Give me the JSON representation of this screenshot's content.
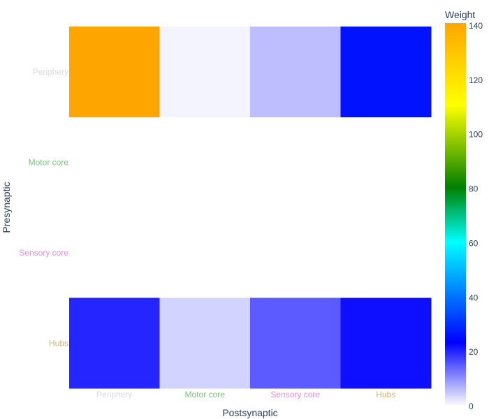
{
  "chart_data": {
    "type": "heatmap",
    "x_title": "Postsynaptic",
    "y_title": "Presynaptic",
    "x_categories": [
      "Periphery",
      "Motor core",
      "Sensory core",
      "Hubs"
    ],
    "y_categories": [
      "Periphery",
      "Motor core",
      "Sensory core",
      "Hubs"
    ],
    "category_colors": {
      "Periphery": "#d9d9d9",
      "Motor core": "#7fbf7b",
      "Sensory core": "#e08ee0",
      "Hubs": "#d8b070"
    },
    "z": [
      [
        140,
        1,
        6,
        26
      ],
      [
        null,
        null,
        null,
        null
      ],
      [
        null,
        null,
        null,
        null
      ],
      [
        20,
        4,
        15,
        22
      ]
    ],
    "colorbar": {
      "title": "Weight",
      "min": 0,
      "max": 140,
      "ticks": [
        0,
        20,
        40,
        60,
        80,
        100,
        120,
        140
      ],
      "stops": [
        [
          0.0,
          "#ffffff"
        ],
        [
          0.167,
          "#0000ff"
        ],
        [
          0.429,
          "#00ffff"
        ],
        [
          0.5,
          "#00c080"
        ],
        [
          0.571,
          "#008000"
        ],
        [
          0.786,
          "#ffff00"
        ],
        [
          1.0,
          "#ffa500"
        ]
      ]
    },
    "text_color": "#2a3f5f"
  }
}
